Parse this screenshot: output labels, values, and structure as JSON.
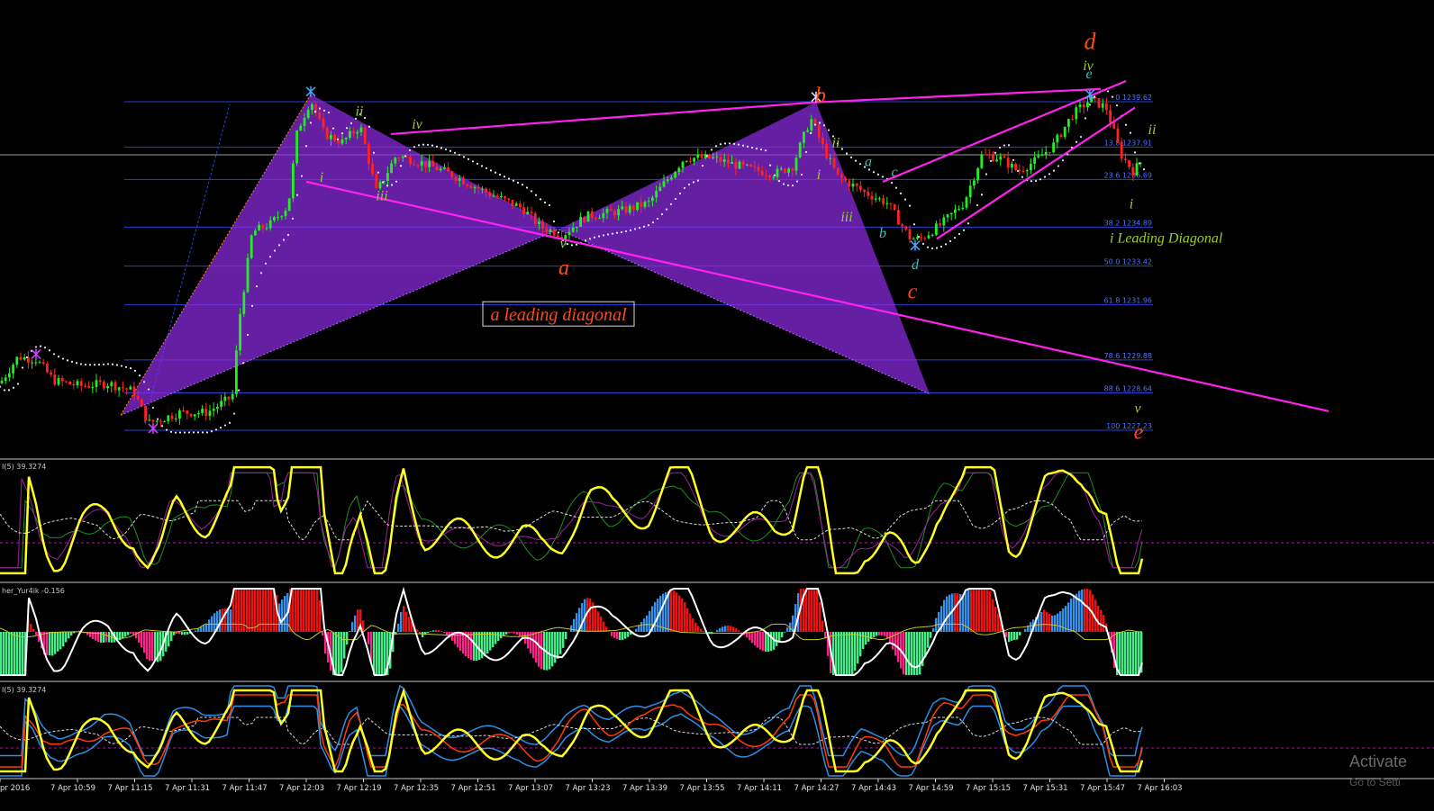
{
  "chart_data": {
    "type": "candlestick",
    "price_range": [
      1226.8,
      1242.2
    ],
    "fib_levels": [
      {
        "label": "0 1239.62",
        "price": 1239.62
      },
      {
        "label": "13.8 1237.91",
        "price": 1237.91
      },
      {
        "label": "23.6 1236.69",
        "price": 1236.69
      },
      {
        "label": "38.2 1234.89",
        "price": 1234.89
      },
      {
        "label": "50.0 1233.42",
        "price": 1233.42
      },
      {
        "label": "61.8 1231.96",
        "price": 1231.96
      },
      {
        "label": "78.6 1229.88",
        "price": 1229.88
      },
      {
        "label": "88.6 1228.64",
        "price": 1228.64
      },
      {
        "label": "100 1227.23",
        "price": 1227.23
      }
    ],
    "x_ticks": [
      "pr 2016",
      "7 Apr 10:59",
      "7 Apr 11:15",
      "7 Apr 11:31",
      "7 Apr 11:47",
      "7 Apr 12:03",
      "7 Apr 12:19",
      "7 Apr 12:35",
      "7 Apr 12:51",
      "7 Apr 13:07",
      "7 Apr 13:23",
      "7 Apr 13:39",
      "7 Apr 13:55",
      "7 Apr 14:11",
      "7 Apr 14:27",
      "7 Apr 14:43",
      "7 Apr 14:59",
      "7 Apr 15:15",
      "7 Apr 15:31",
      "7 Apr 15:47",
      "7 Apr 16:03"
    ],
    "price_path": [
      [
        0,
        1229.0
      ],
      [
        20,
        1230.0
      ],
      [
        40,
        1229.9
      ],
      [
        60,
        1229.1
      ],
      [
        90,
        1228.9
      ],
      [
        120,
        1229.0
      ],
      [
        148,
        1228.7
      ],
      [
        165,
        1227.5
      ],
      [
        175,
        1227.6
      ],
      [
        200,
        1227.9
      ],
      [
        230,
        1227.9
      ],
      [
        258,
        1228.5
      ],
      [
        266,
        1231.5
      ],
      [
        280,
        1234.7
      ],
      [
        300,
        1235.0
      ],
      [
        320,
        1235.7
      ],
      [
        330,
        1238.5
      ],
      [
        345,
        1239.7
      ],
      [
        360,
        1238.4
      ],
      [
        380,
        1238.1
      ],
      [
        400,
        1238.7
      ],
      [
        418,
        1236.2
      ],
      [
        440,
        1237.6
      ],
      [
        470,
        1237.3
      ],
      [
        500,
        1236.9
      ],
      [
        540,
        1236.2
      ],
      [
        580,
        1235.6
      ],
      [
        600,
        1234.9
      ],
      [
        625,
        1234.6
      ],
      [
        650,
        1235.3
      ],
      [
        690,
        1235.5
      ],
      [
        720,
        1235.8
      ],
      [
        760,
        1237.5
      ],
      [
        790,
        1237.5
      ],
      [
        830,
        1237.1
      ],
      [
        860,
        1236.9
      ],
      [
        880,
        1237.2
      ],
      [
        900,
        1239.0
      ],
      [
        915,
        1237.8
      ],
      [
        930,
        1236.8
      ],
      [
        960,
        1236.2
      ],
      [
        985,
        1235.8
      ],
      [
        1010,
        1234.5
      ],
      [
        1020,
        1234.4
      ],
      [
        1045,
        1235.0
      ],
      [
        1070,
        1235.8
      ],
      [
        1090,
        1237.6
      ],
      [
        1110,
        1237.5
      ],
      [
        1130,
        1237.0
      ],
      [
        1150,
        1237.4
      ],
      [
        1170,
        1238.0
      ],
      [
        1190,
        1239.1
      ],
      [
        1210,
        1239.7
      ],
      [
        1228,
        1239.4
      ],
      [
        1245,
        1237.6
      ],
      [
        1258,
        1237.0
      ],
      [
        1268,
        1237.4
      ]
    ],
    "wave_labels": [
      {
        "text": "d",
        "price": 1241.6,
        "x": 1210,
        "color": "#ff4a14",
        "size": 26
      },
      {
        "text": "iv",
        "price": 1240.8,
        "x": 1208,
        "color": "#9acd32",
        "size": 16
      },
      {
        "text": "e",
        "price": 1240.5,
        "x": 1209,
        "color": "#40c0c0",
        "size": 16
      },
      {
        "text": "b",
        "price": 1239.6,
        "x": 911,
        "color": "#ff4a14",
        "size": 24
      },
      {
        "text": "ii",
        "price": 1239.1,
        "x": 399,
        "color": "#9acd32",
        "size": 16
      },
      {
        "text": "iv",
        "price": 1238.6,
        "x": 463,
        "color": "#9acd32",
        "size": 16
      },
      {
        "text": "ii",
        "price": 1238.4,
        "x": 1279,
        "color": "#9acd32",
        "size": 16
      },
      {
        "text": "ii",
        "price": 1237.9,
        "x": 928,
        "color": "#9acd32",
        "size": 16
      },
      {
        "text": "a",
        "price": 1237.2,
        "x": 964,
        "color": "#40c0c0",
        "size": 16
      },
      {
        "text": "i",
        "price": 1236.6,
        "x": 357,
        "color": "#9acd32",
        "size": 16
      },
      {
        "text": "i",
        "price": 1236.7,
        "x": 909,
        "color": "#9acd32",
        "size": 16
      },
      {
        "text": "c",
        "price": 1236.8,
        "x": 993,
        "color": "#40c0c0",
        "size": 16
      },
      {
        "text": "iii",
        "price": 1235.9,
        "x": 424,
        "color": "#9acd32",
        "size": 16
      },
      {
        "text": "i",
        "price": 1235.6,
        "x": 1256,
        "color": "#9acd32",
        "size": 16
      },
      {
        "text": "iii",
        "price": 1235.1,
        "x": 940,
        "color": "#9acd32",
        "size": 16
      },
      {
        "text": "b",
        "price": 1234.5,
        "x": 980,
        "color": "#40c0c0",
        "size": 16
      },
      {
        "text": "v",
        "price": 1234.1,
        "x": 625,
        "color": "#9acd32",
        "size": 16
      },
      {
        "text": "i Leading Diagonal",
        "price": 1234.3,
        "x": 1232,
        "color": "#9acd32",
        "size": 16
      },
      {
        "text": "d",
        "price": 1233.3,
        "x": 1016,
        "color": "#40c0c0",
        "size": 16
      },
      {
        "text": "a",
        "price": 1233.1,
        "x": 626,
        "color": "#ff4a14",
        "size": 24
      },
      {
        "text": "c",
        "price": 1232.2,
        "x": 1013,
        "color": "#ff4a14",
        "size": 24
      },
      {
        "text": "v",
        "price": 1227.9,
        "x": 1263,
        "color": "#9acd32",
        "size": 16
      },
      {
        "text": "e",
        "price": 1226.9,
        "x": 1264,
        "color": "#ff4a14",
        "size": 24
      }
    ],
    "annotation_box": {
      "text": "a leading diagonal",
      "price": 1231.5,
      "x": 620,
      "color": "#ff4a14"
    },
    "indicators": [
      {
        "name": "RSI",
        "label": "I(5) 39.3274"
      },
      {
        "name": "Fisher",
        "label": "her_Yur4ik -0.156"
      },
      {
        "name": "RSI bands",
        "label": "I(5) 39.3274"
      }
    ]
  },
  "watermark": {
    "line1": "Activate",
    "line2": "Go to Setti"
  }
}
